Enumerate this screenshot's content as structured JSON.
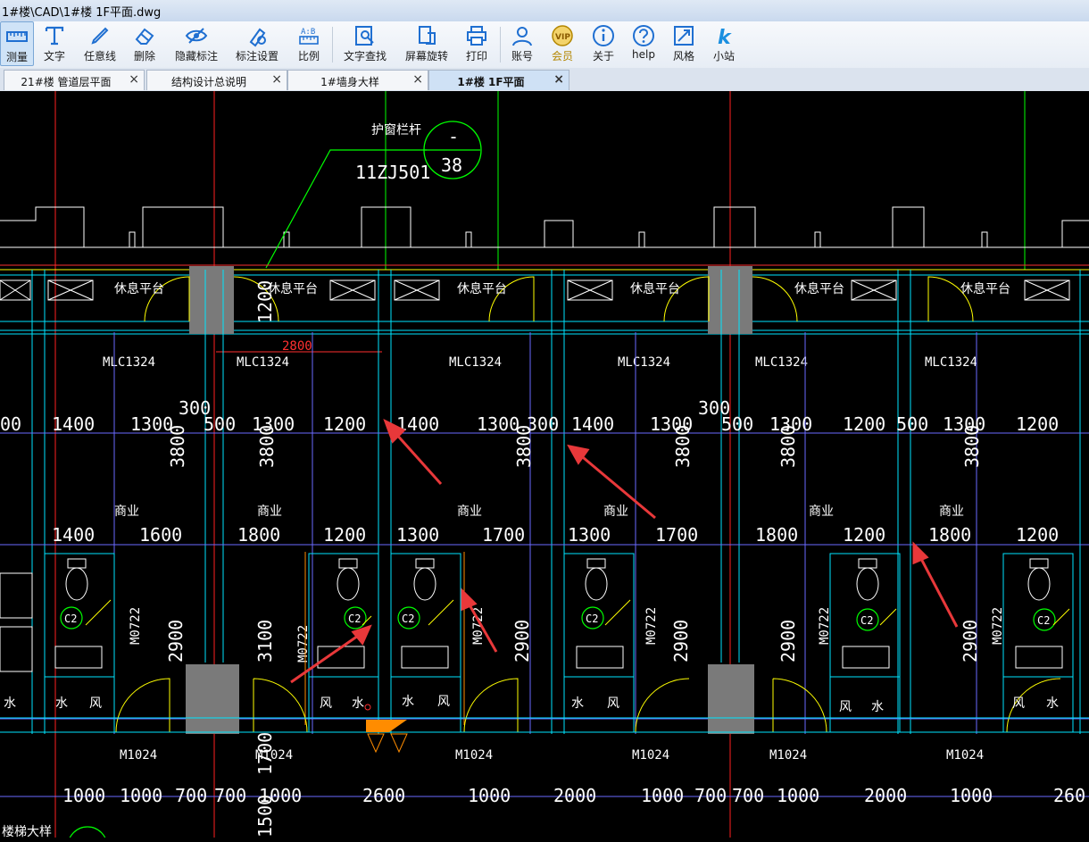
{
  "window": {
    "title": "1#楼\\CAD\\1#楼 1F平面.dwg"
  },
  "toolbar": {
    "items": [
      {
        "label": "测量",
        "icon": "measure-icon"
      },
      {
        "label": "文字",
        "icon": "text-icon"
      },
      {
        "label": "任意线",
        "icon": "pen-icon"
      },
      {
        "label": "删除",
        "icon": "eraser-icon"
      },
      {
        "label": "隐藏标注",
        "icon": "hide-eye-icon"
      },
      {
        "label": "标注设置",
        "icon": "annotation-settings-icon"
      },
      {
        "label": "比例",
        "icon": "scale-icon"
      },
      {
        "label": "文字查找",
        "icon": "text-search-icon"
      },
      {
        "label": "屏幕旋转",
        "icon": "rotate-screen-icon"
      },
      {
        "label": "打印",
        "icon": "printer-icon"
      },
      {
        "label": "账号",
        "icon": "user-icon"
      },
      {
        "label": "会员",
        "icon": "vip-icon"
      },
      {
        "label": "关于",
        "icon": "info-icon"
      },
      {
        "label": "help",
        "icon": "help-icon"
      },
      {
        "label": "风格",
        "icon": "style-icon"
      },
      {
        "label": "小站",
        "icon": "station-k-icon"
      }
    ],
    "active_index": 0
  },
  "tabs": [
    {
      "label": "21#楼 管道层平面"
    },
    {
      "label": "结构设计总说明"
    },
    {
      "label": "1#墙身大样"
    },
    {
      "label": "1#楼 1F平面"
    }
  ],
  "active_tab": 3,
  "close_glyph": "×",
  "drawing": {
    "callout_title": "护窗栏杆",
    "callout_ref": "11ZJ501",
    "callout_top": "-",
    "callout_num": "38",
    "rest_platform": "休息平台",
    "dim_1200_vert": "1200",
    "dim_2800": "2800",
    "window_code": "MLC1324",
    "dim_300": "300",
    "row1_dims": [
      "00",
      "1400",
      "1300",
      "500",
      "1300",
      "1200",
      "1400",
      "1300",
      "300",
      "1400",
      "1300",
      "500",
      "1300",
      "1200",
      "500",
      "1300",
      "1200"
    ],
    "dim_3800": "3800",
    "shop": "商业",
    "row2_dims": [
      "1400",
      "1600",
      "1800",
      "1200",
      "1300",
      "1700",
      "1300",
      "1700",
      "1800",
      "1200",
      "1800",
      "1200"
    ],
    "toilet_code": "C2",
    "door_small": "M0722",
    "dim_2900": "2900",
    "dim_3100": "3100",
    "water": "水",
    "wind": "风",
    "door_main": "M1024",
    "dim_1500_vert": "1500",
    "dim_1700_vert": "1700",
    "row3_dims": [
      "1000",
      "1000",
      "700",
      "700",
      "1000",
      "2600",
      "1000",
      "2000",
      "1000",
      "700",
      "700",
      "1000",
      "2000",
      "1000",
      "260"
    ],
    "stair_detail": "楼梯大样",
    "colors": {
      "cyan": "#00e5ff",
      "green": "#00ff00",
      "yellow": "#ffff00",
      "red": "#ff2020",
      "arrow": "#e8383a",
      "dim_red": "#ff3030",
      "grey": "#7a7a7a",
      "blue": "#6a6aff",
      "orange": "#ff8c00"
    }
  }
}
